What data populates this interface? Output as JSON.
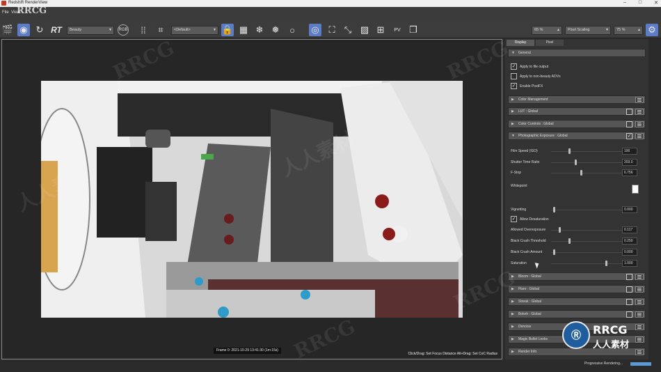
{
  "window": {
    "title": "Redshift RenderView"
  },
  "menu": [
    "File",
    "View"
  ],
  "watermark": "RRCG",
  "watermark_cn": "人人素材",
  "toolbar": {
    "rt_label": "RT",
    "aov_combo": "Beauty",
    "channel_label": "RGB",
    "camera_combo": "<Default>",
    "zoom_value": "65 %",
    "pixel_scaling": "Pixel Scaling",
    "scale_value": "75 %"
  },
  "panel": {
    "tabs": [
      "Display",
      "Pixel"
    ],
    "general": "General",
    "checks": [
      {
        "label": "Apply to file output",
        "checked": true
      },
      {
        "label": "Apply to non-beauty AOVs",
        "checked": false
      },
      {
        "label": "Enable PostFX",
        "checked": true
      }
    ],
    "sections_top": [
      {
        "label": "Color Management",
        "check": false,
        "has_check": false
      },
      {
        "label": "LUT   : Global",
        "check": false,
        "has_check": true
      },
      {
        "label": "Color Controls  : Global",
        "check": false,
        "has_check": true
      },
      {
        "label": "Photographic Exposure  : Global",
        "check": true,
        "has_check": true,
        "open": true
      }
    ],
    "exposure": [
      {
        "label": "Film Speed (ISO)",
        "value": "100",
        "pos": 0.25
      },
      {
        "label": "Shutter Time Ratio",
        "value": "203.0",
        "pos": 0.34
      },
      {
        "label": "F-Stop",
        "value": "6.756",
        "pos": 0.42
      }
    ],
    "whitepoint_label": "Whitepoint",
    "vignetting": {
      "label": "Vignetting",
      "value": "0.000",
      "pos": 0.03
    },
    "allow_desat": {
      "label": "Allow Desaturation",
      "checked": true
    },
    "exposure2": [
      {
        "label": "Allowed Overexposure",
        "value": "0.117",
        "pos": 0.11
      },
      {
        "label": "Black Crush Threshold",
        "value": "0.250",
        "pos": 0.25
      },
      {
        "label": "Black Crush Amount",
        "value": "0.000",
        "pos": 0.03
      },
      {
        "label": "Saturation",
        "value": "1.000",
        "pos": 0.78
      }
    ],
    "sections_bottom": [
      {
        "label": "Bloom  : Global",
        "has_check": true
      },
      {
        "label": "Flare  : Global",
        "has_check": true
      },
      {
        "label": "Streak  : Global",
        "has_check": true
      },
      {
        "label": "Bokeh  : Global",
        "has_check": true
      },
      {
        "label": "Denoise",
        "has_check": false
      },
      {
        "label": "Magic Bullet Looks",
        "has_check": false
      },
      {
        "label": "Render Info",
        "has_check": false
      }
    ]
  },
  "viewport": {
    "frame_info": "Frame  0:  2021-10-29  13:41:30  (1m:15s)",
    "hint": "Click/Drag: Set Focus Distance  Alt+Drag: Set CoC Radius"
  },
  "status": {
    "text": "Progressive Rendering...",
    "progress": 1.0
  },
  "logo": {
    "title": "RRCG",
    "subtitle": "人人素材"
  },
  "colors": {
    "accent": "#5d7cc6",
    "panel": "#333333",
    "background": "#2b2b2b"
  }
}
